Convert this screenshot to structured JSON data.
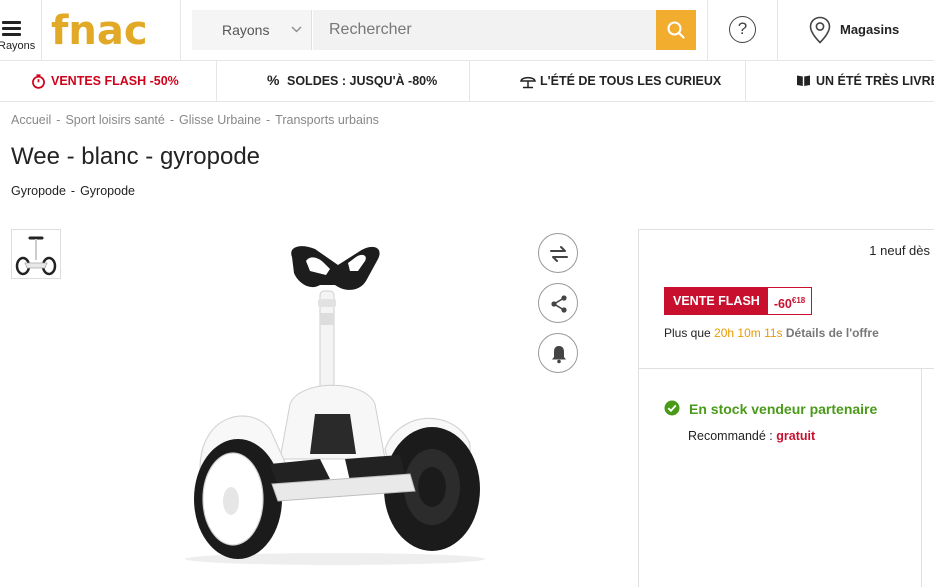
{
  "header": {
    "menu_label": "Rayons",
    "logo_text": "fnac",
    "brand_color": "#E1A925",
    "search": {
      "category_label": "Rayons",
      "placeholder": "Rechercher",
      "button_color": "#F2AD2E"
    },
    "help_symbol": "?",
    "stores_label": "Magasins"
  },
  "promo_nav": [
    {
      "label": "Ventes flash -50%",
      "icon": "stopwatch-icon"
    },
    {
      "label": "Soldes : jusqu'à -80%",
      "icon": "percent-icon"
    },
    {
      "label": "L'été de tous les curieux",
      "icon": "parasol-icon"
    },
    {
      "label": "Un été très livre",
      "icon": "book-icon"
    }
  ],
  "breadcrumb": [
    "Accueil",
    "Sport loisirs santé",
    "Glisse Urbaine",
    "Transports urbains"
  ],
  "product": {
    "title": "Wee - blanc - gyropode",
    "categories": [
      "Gyropode",
      "Gyropode"
    ]
  },
  "offer": {
    "count_text": "1 neuf dès",
    "flash_label": "VENTE FLASH",
    "discount_main": "-60",
    "discount_cents": "€18",
    "timer_prefix": "Plus que",
    "timer_value": "20h 10m 11s",
    "details_link": "Détails de l'offre",
    "stock_text": "En stock vendeur partenaire",
    "recommended_label": "Recommandé :",
    "recommended_value": "gratuit",
    "flash_color": "#C8102E",
    "stock_color": "#4A9A1A"
  }
}
